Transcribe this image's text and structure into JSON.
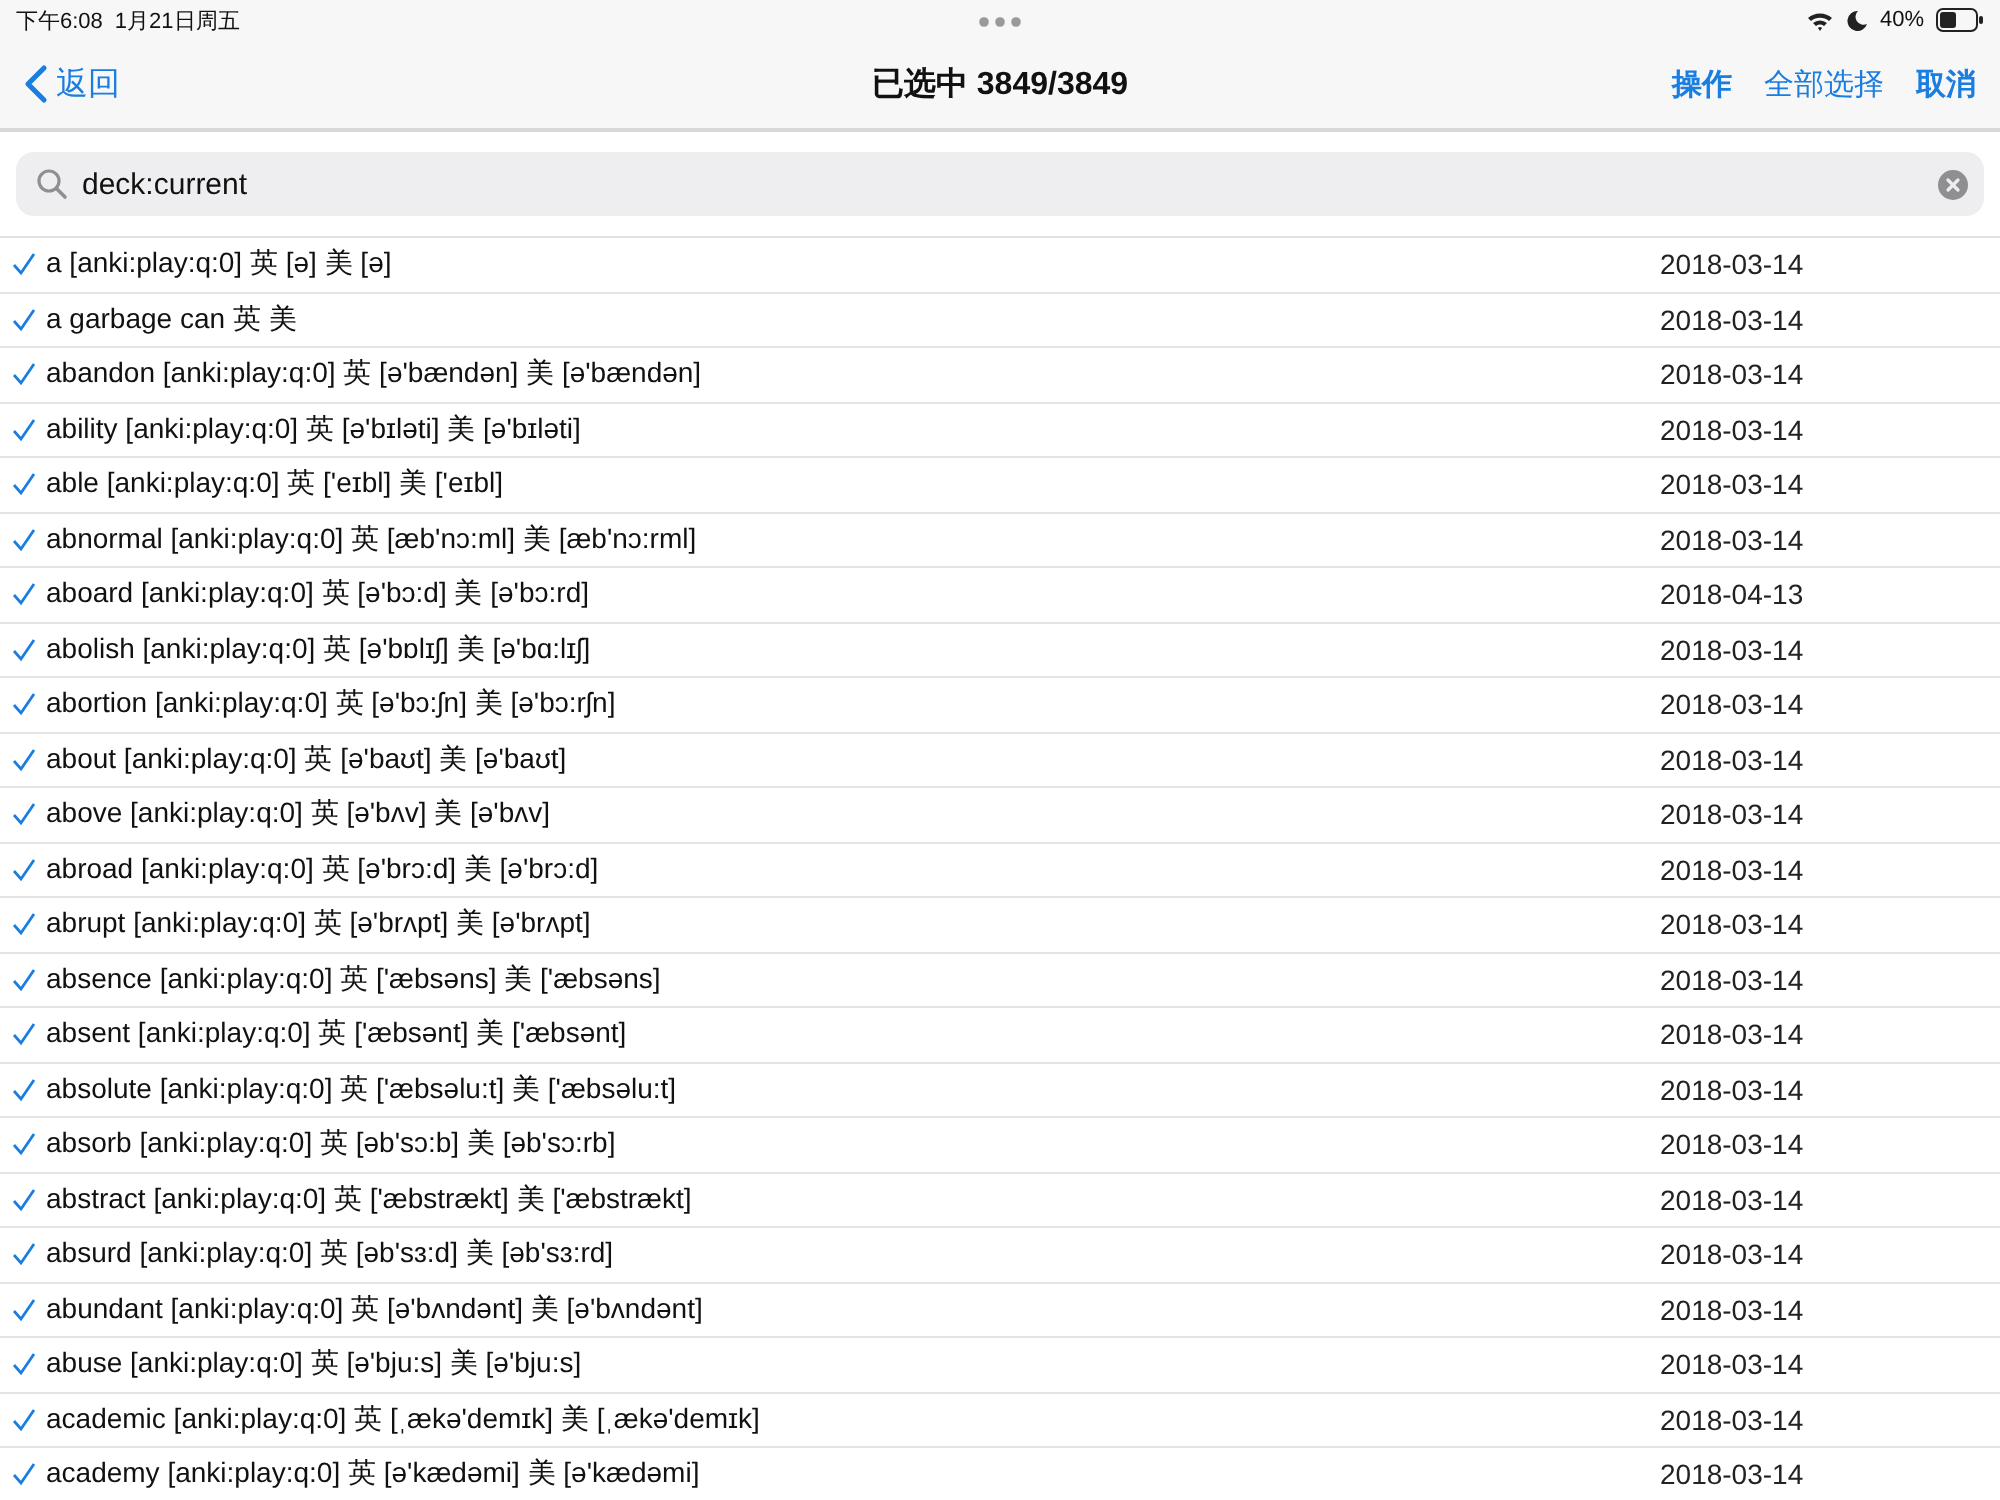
{
  "status_bar": {
    "time": "下午6:08",
    "date": "1月21日周五",
    "battery": "40%"
  },
  "nav": {
    "back": "返回",
    "title": "已选中 3849/3849",
    "actions": [
      "操作",
      "全部选择",
      "取消"
    ]
  },
  "search": {
    "value": "deck:current"
  },
  "rows": [
    {
      "text": "a [anki:play:q:0] 英 [ə] 美 [ə]",
      "date": "2018-03-14",
      "checked": true
    },
    {
      "text": "a garbage can 英 美",
      "date": "2018-03-14",
      "checked": true
    },
    {
      "text": "abandon [anki:play:q:0] 英 [ə'bændən] 美 [ə'bændən]",
      "date": "2018-03-14",
      "checked": true
    },
    {
      "text": "ability [anki:play:q:0] 英 [ə'bɪləti] 美 [ə'bɪləti]",
      "date": "2018-03-14",
      "checked": true
    },
    {
      "text": "able [anki:play:q:0] 英 ['eɪbl] 美 ['eɪbl]",
      "date": "2018-03-14",
      "checked": true
    },
    {
      "text": "abnormal [anki:play:q:0] 英 [æb'nɔ:ml] 美 [æb'nɔ:rml]",
      "date": "2018-03-14",
      "checked": true
    },
    {
      "text": "aboard [anki:play:q:0] 英 [ə'bɔ:d] 美 [ə'bɔ:rd]",
      "date": "2018-04-13",
      "checked": true
    },
    {
      "text": "abolish [anki:play:q:0] 英 [ə'bɒlɪʃ] 美 [ə'bɑ:lɪʃ]",
      "date": "2018-03-14",
      "checked": true
    },
    {
      "text": "abortion [anki:play:q:0] 英 [ə'bɔ:ʃn] 美 [ə'bɔ:rʃn]",
      "date": "2018-03-14",
      "checked": true
    },
    {
      "text": "about [anki:play:q:0] 英 [ə'baʊt] 美 [ə'baʊt]",
      "date": "2018-03-14",
      "checked": true
    },
    {
      "text": "above [anki:play:q:0] 英 [ə'bʌv] 美 [ə'bʌv]",
      "date": "2018-03-14",
      "checked": true
    },
    {
      "text": "abroad [anki:play:q:0] 英 [ə'brɔ:d] 美 [ə'brɔ:d]",
      "date": "2018-03-14",
      "checked": true
    },
    {
      "text": "abrupt [anki:play:q:0] 英 [ə'brʌpt] 美 [ə'brʌpt]",
      "date": "2018-03-14",
      "checked": true
    },
    {
      "text": "absence [anki:play:q:0] 英 ['æbsəns] 美 ['æbsəns]",
      "date": "2018-03-14",
      "checked": true
    },
    {
      "text": "absent [anki:play:q:0] 英 ['æbsənt] 美 ['æbsənt]",
      "date": "2018-03-14",
      "checked": true
    },
    {
      "text": "absolute [anki:play:q:0] 英 ['æbsəlu:t] 美 ['æbsəlu:t]",
      "date": "2018-03-14",
      "checked": true
    },
    {
      "text": "absorb [anki:play:q:0] 英 [əb'sɔ:b] 美 [əb'sɔ:rb]",
      "date": "2018-03-14",
      "checked": true
    },
    {
      "text": "abstract [anki:play:q:0] 英 ['æbstrækt] 美 ['æbstrækt]",
      "date": "2018-03-14",
      "checked": true
    },
    {
      "text": "absurd [anki:play:q:0] 英 [əb'sɜ:d] 美 [əb'sɜ:rd]",
      "date": "2018-03-14",
      "checked": true
    },
    {
      "text": "abundant [anki:play:q:0] 英 [ə'bʌndənt] 美 [ə'bʌndənt]",
      "date": "2018-03-14",
      "checked": true
    },
    {
      "text": "abuse [anki:play:q:0] 英 [ə'bju:s] 美 [ə'bju:s]",
      "date": "2018-03-14",
      "checked": true
    },
    {
      "text": "academic [anki:play:q:0] 英 [ˌækə'demɪk] 美 [ˌækə'demɪk]",
      "date": "2018-03-14",
      "checked": true
    },
    {
      "text": "academy [anki:play:q:0] 英 [ə'kædəmi] 美 [ə'kædəmi]",
      "date": "2018-03-14",
      "checked": true
    }
  ]
}
